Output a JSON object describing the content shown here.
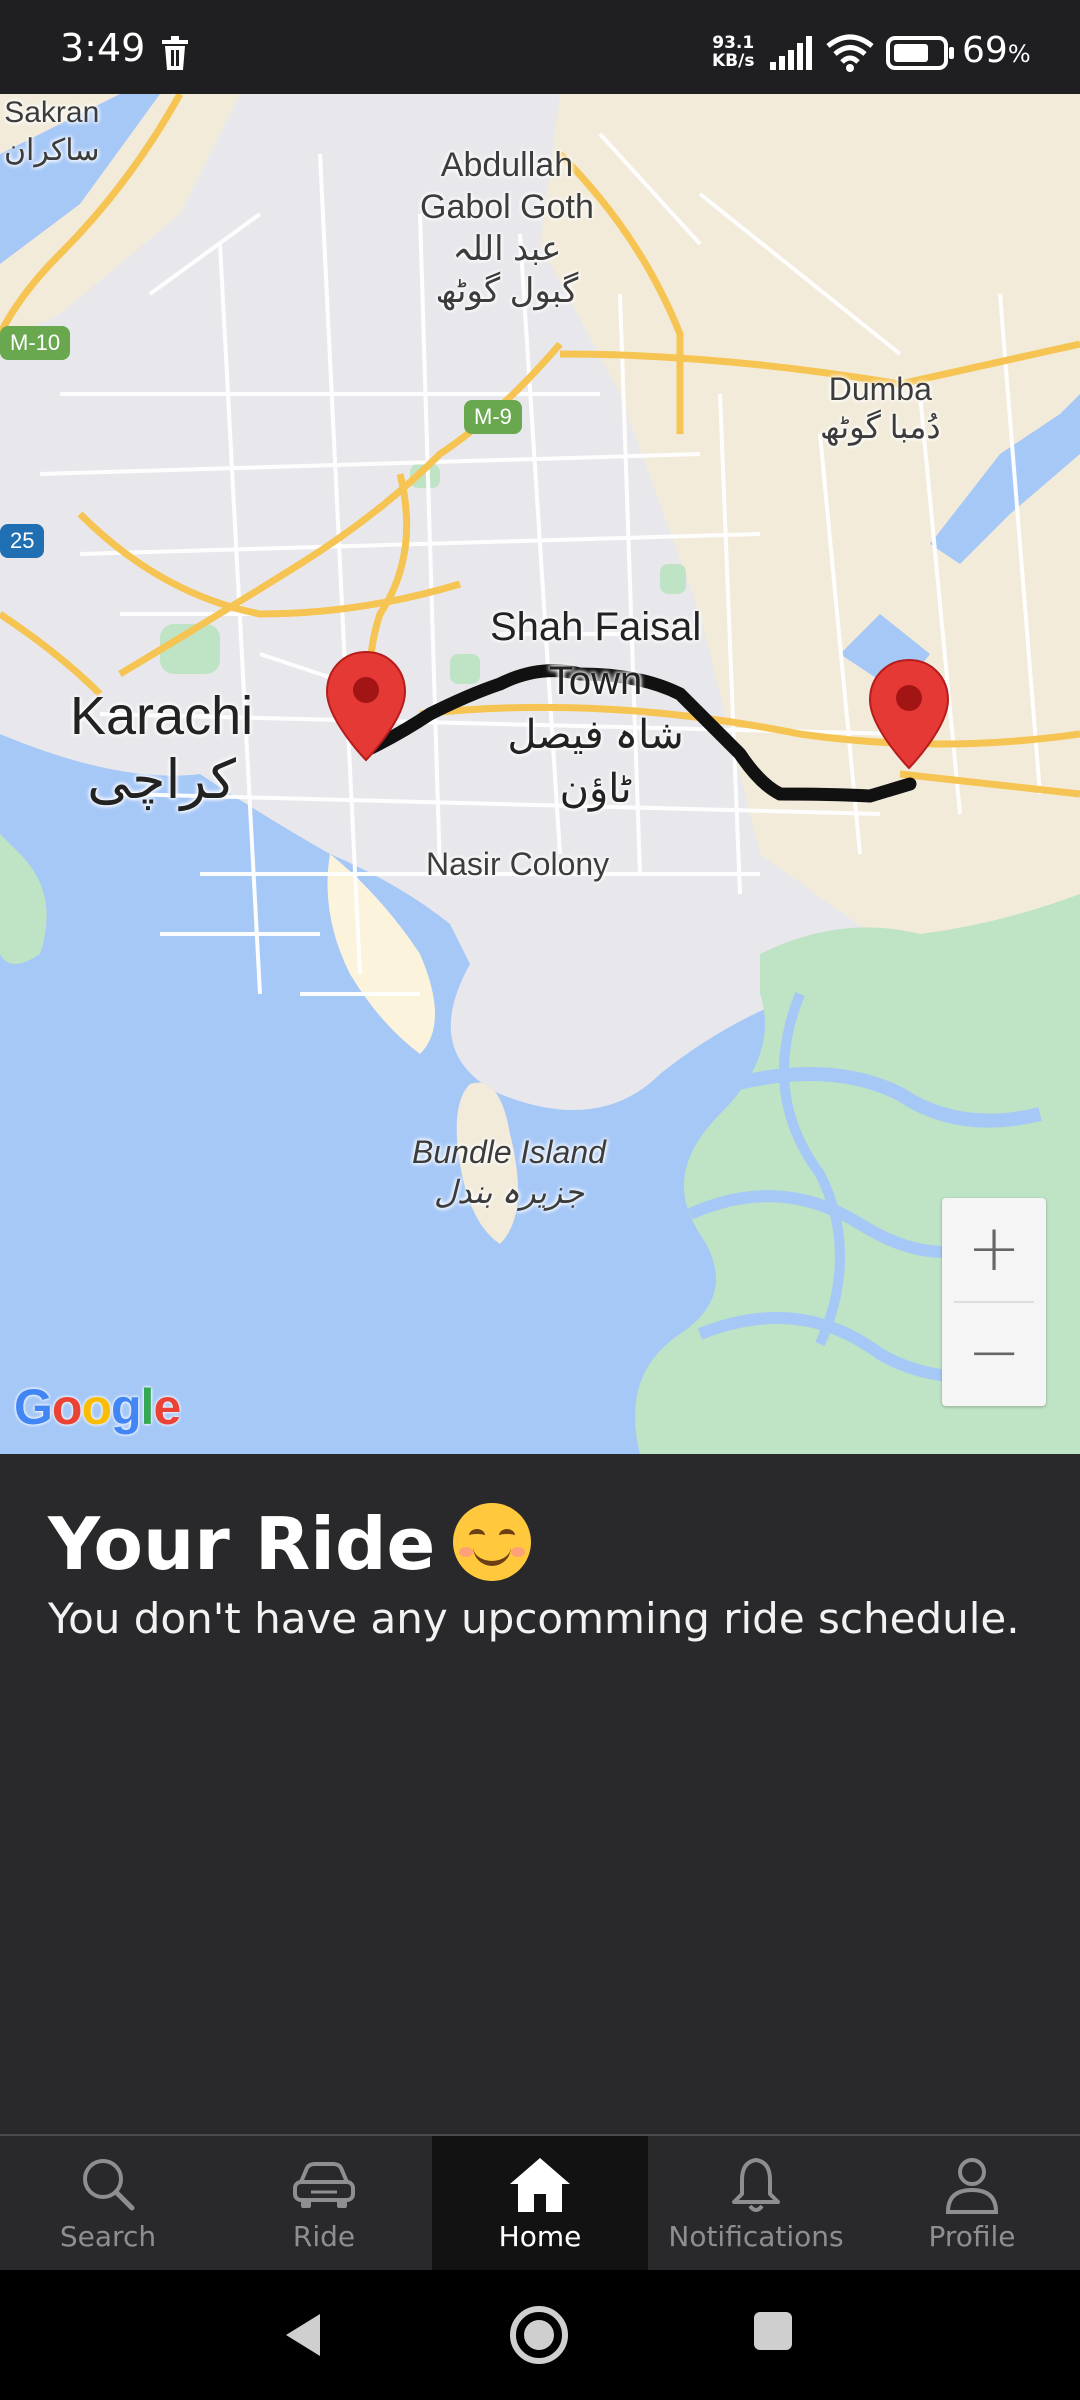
{
  "status_bar": {
    "time": "3:49",
    "network_speed_value": "93.1",
    "network_speed_unit": "KB/s",
    "battery_percent": "69",
    "battery_symbol": "%"
  },
  "map": {
    "labels": {
      "sakran": "Sakran",
      "sakran_urdu": "ساکران",
      "abdullah": "Abdullah",
      "abdullah_2": "Gabol Goth",
      "abdullah_urdu": "عبد اللہ",
      "abdullah_urdu_2": "گبول گوٹھ",
      "dumba": "Dumba",
      "dumba_urdu": "دُمبا گوٹھ",
      "shah_faisal": "Shah Faisal",
      "shah_faisal_2": "Town",
      "shah_faisal_urdu": "شاہ فیصل",
      "shah_faisal_urdu_2": "ٹاؤن",
      "karachi": "Karachi",
      "karachi_urdu": "کراچی",
      "nasir_colony": "Nasir Colony",
      "bundle_island": "Bundle Island",
      "bundle_island_urdu": "جزیرہ بندل"
    },
    "shields": {
      "m9": "M-9",
      "m10": "M-10",
      "n25": "25"
    },
    "zoom_in_label": "+",
    "zoom_out_label": "−",
    "attribution": "Google",
    "colors": {
      "water": "#a6c8f7",
      "land": "#e8e8ec",
      "park": "#bfe3c5",
      "sand": "#f2ebd9",
      "highway": "#f6c452",
      "route": "#111111",
      "marker": "#e53935"
    }
  },
  "ride": {
    "title": "Your Ride",
    "emoji": "smiling-face",
    "subtitle": "You don't have any upcomming ride schedule."
  },
  "nav": {
    "items": [
      {
        "label": "Search",
        "icon": "search-icon",
        "active": false
      },
      {
        "label": "Ride",
        "icon": "car-icon",
        "active": false
      },
      {
        "label": "Home",
        "icon": "home-icon",
        "active": true
      },
      {
        "label": "Notifications",
        "icon": "bell-icon",
        "active": false
      },
      {
        "label": "Profile",
        "icon": "person-icon",
        "active": false
      }
    ]
  }
}
